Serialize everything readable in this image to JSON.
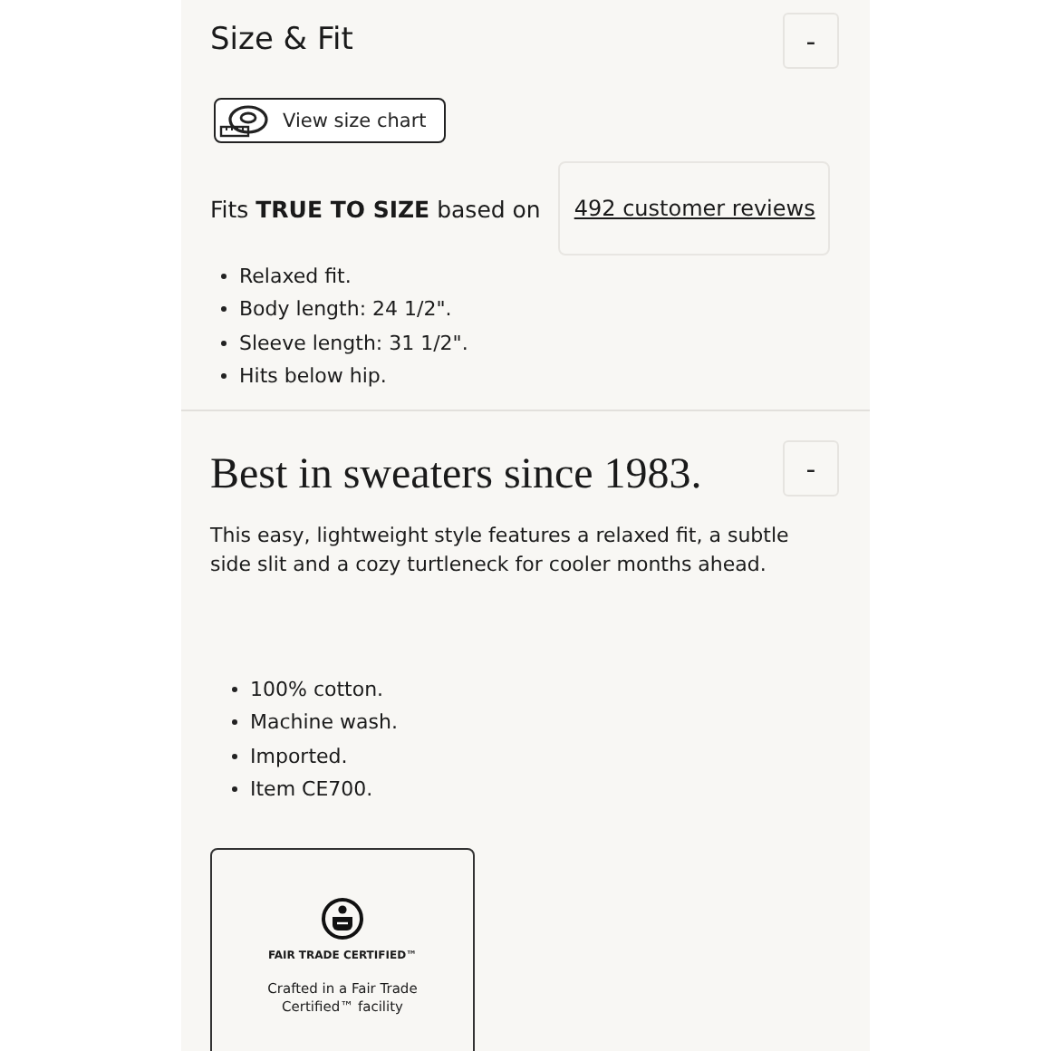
{
  "sections": [
    {
      "kind": "fit",
      "title": "Size & Fit",
      "toggle": "-",
      "size_chart_button": "View size chart",
      "fit_text": "Fits **TRUE TO SIZE** based on",
      "reviews_link": "492 customer reviews",
      "bullets": [
        "Relaxed fit.",
        "Body length: 24 1/2\".",
        "Sleeve length: 31 1/2\".",
        "Hits below hip."
      ]
    },
    {
      "kind": "details",
      "title": "Best in sweaters since 1983.",
      "toggle": "-",
      "description": "This easy, lightweight style features a relaxed fit, a subtle side slit and a cozy turtleneck for cooler months ahead.",
      "bullets": [
        "100% cotton.",
        "Machine wash.",
        "Imported.",
        "Item CE700."
      ],
      "certification": {
        "label": "FAIR TRADE CERTIFIED™",
        "text": "Crafted in a Fair Trade Certified™ facility"
      }
    }
  ]
}
